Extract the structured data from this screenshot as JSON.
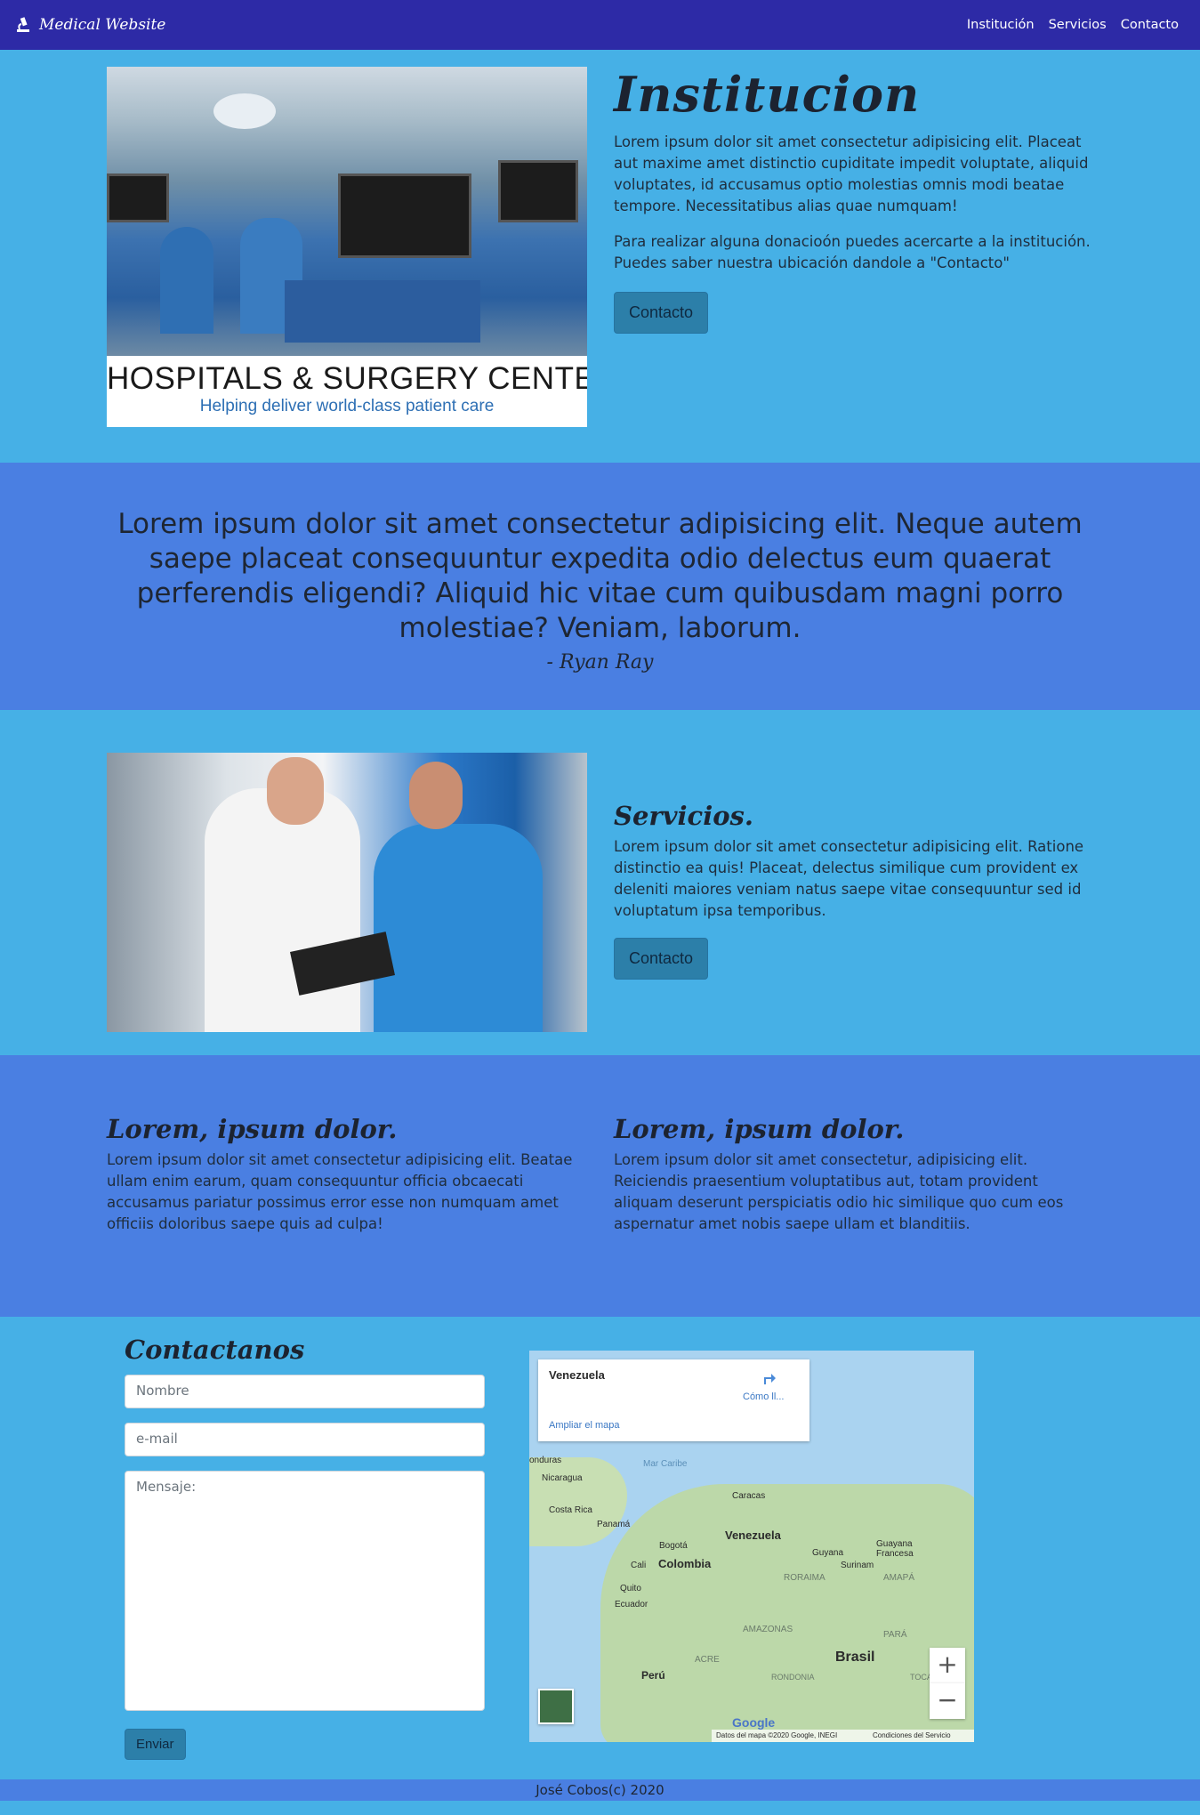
{
  "nav": {
    "brand": "Medical Website",
    "links": [
      "Institución",
      "Servicios",
      "Contacto"
    ]
  },
  "institucion": {
    "title": "Institucion",
    "p1": "Lorem ipsum dolor sit amet consectetur adipisicing elit. Placeat aut maxime amet distinctio cupiditate impedit voluptate, aliquid voluptates, id accusamus optio molestias omnis modi beatae tempore. Necessitatibus alias quae numquam!",
    "p2": "Para realizar alguna donacioón puedes acercarte a la institución. Puedes saber nuestra ubicación dandole a \"Contacto\"",
    "button": "Contacto",
    "image_banner": "HOSPITALS & SURGERY CENTER",
    "image_tagline": "Helping deliver world-class patient care"
  },
  "quote": {
    "text": "Lorem ipsum dolor sit amet consectetur adipisicing elit. Neque autem saepe placeat consequuntur expedita odio delectus eum quaerat perferendis eligendi? Aliquid hic vitae cum quibusdam magni porro molestiae? Veniam, laborum.",
    "author": "- Ryan Ray"
  },
  "servicios": {
    "title": "Servicios.",
    "p": "Lorem ipsum dolor sit amet consectetur adipisicing elit. Ratione distinctio ea quis! Placeat, delectus similique cum provident ex deleniti maiores veniam natus saepe vitae consequuntur sed id voluptatum ipsa temporibus.",
    "button": "Contacto"
  },
  "features": [
    {
      "title": "Lorem, ipsum dolor.",
      "text": "Lorem ipsum dolor sit amet consectetur adipisicing elit. Beatae ullam enim earum, quam consequuntur officia obcaecati accusamus pariatur possimus error esse non numquam amet officiis doloribus saepe quis ad culpa!"
    },
    {
      "title": "Lorem, ipsum dolor.",
      "text": "Lorem ipsum dolor sit amet consectetur, adipisicing elit. Reiciendis praesentium voluptatibus aut, totam provident aliquam deserunt perspiciatis odio hic similique quo cum eos aspernatur amet nobis saepe ullam et blanditiis."
    }
  ],
  "contact": {
    "title": "Contactanos",
    "name_placeholder": "Nombre",
    "email_placeholder": "e-mail",
    "message_placeholder": "Mensaje:",
    "submit": "Enviar"
  },
  "map": {
    "place": "Venezuela",
    "directions": "Cómo ll...",
    "enlarge": "Ampliar el mapa",
    "labels": {
      "mar_caribe": "Mar Caribe",
      "nicaragua": "Nicaragua",
      "honduras": "onduras",
      "costa_rica": "Costa Rica",
      "panama": "Panamá",
      "caracas": "Caracas",
      "venezuela": "Venezuela",
      "bogota": "Bogotá",
      "colombia": "Colombia",
      "cali": "Cali",
      "guyana": "Guyana",
      "guayana_francesa": "Guayana Francesa",
      "surinam": "Surinam",
      "roraima": "RORAIMA",
      "amapa": "AMAPÁ",
      "quito": "Quito",
      "ecuador": "Ecuador",
      "amazonas": "AMAZONAS",
      "para": "PARÁ",
      "acre": "ACRE",
      "brasil": "Brasil",
      "peru": "Perú",
      "rondonia": "RONDONIA",
      "tocantins": "TOCANTINS"
    },
    "attribution": "Datos del mapa ©2020 Google, INEGI",
    "terms": "Condiciones del Servicio",
    "google": "Google"
  },
  "footer": "José Cobos(c) 2020"
}
